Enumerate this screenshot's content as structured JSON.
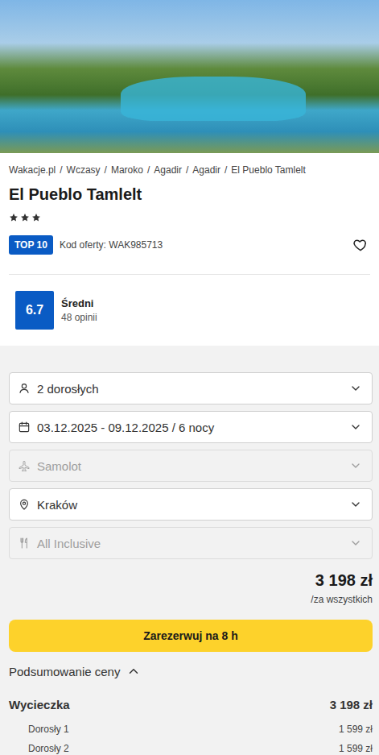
{
  "breadcrumb": {
    "items": [
      "Wakacje.pl",
      "Wczasy",
      "Maroko",
      "Agadir",
      "Agadir",
      "El Pueblo Tamlelt"
    ],
    "separator": "/"
  },
  "hotel": {
    "name": "El Pueblo Tamlelt",
    "stars": 3
  },
  "badge": "TOP 10",
  "offer_code": "Kod oferty: WAK985713",
  "favorite": false,
  "rating": {
    "score": "6.7",
    "label": "Średni",
    "reviews": "48 opinii"
  },
  "fields": [
    {
      "kind": "travelers",
      "value": "2 dorosłych",
      "disabled": false
    },
    {
      "kind": "dates",
      "value": "03.12.2025 - 09.12.2025 / 6 nocy",
      "disabled": false
    },
    {
      "kind": "transport",
      "value": "Samolot",
      "disabled": true
    },
    {
      "kind": "departure",
      "value": "Kraków",
      "disabled": false
    },
    {
      "kind": "board",
      "value": "All Inclusive",
      "disabled": true
    }
  ],
  "price": {
    "total": "3 198 zł",
    "note": "/za wszystkich"
  },
  "book_button": "Zarezerwuj na 8 h",
  "summary": {
    "title": "Podsumowanie ceny",
    "expanded": true,
    "rows": [
      {
        "kind": "total",
        "label": "Wycieczka",
        "amount": "3 198 zł"
      },
      {
        "kind": "item",
        "label": "Dorosły 1",
        "amount": "1 599 zł"
      },
      {
        "kind": "item",
        "label": "Dorosły 2",
        "amount": "1 599 zł"
      }
    ]
  }
}
